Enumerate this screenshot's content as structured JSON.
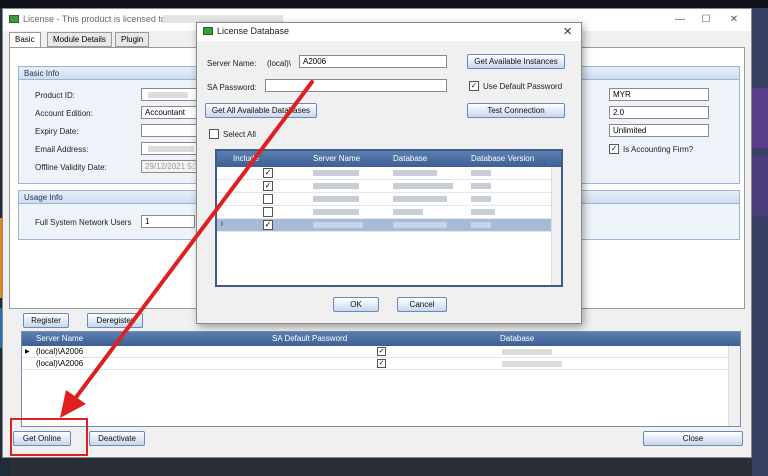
{
  "window": {
    "title": "License - This product is licensed to",
    "minimize": "—",
    "maximize": "☐",
    "close": "✕"
  },
  "tabs": [
    {
      "label": "Basic"
    },
    {
      "label": "Module Details"
    },
    {
      "label": "Plugin"
    }
  ],
  "basic_info": {
    "header": "Basic Info",
    "product_id_label": "Product ID:",
    "account_edition_label": "Account Edition:",
    "account_edition_value": "Accountant",
    "expiry_date_label": "Expiry Date:",
    "email_label": "Email Address:",
    "offline_validity_label": "Offline Validity Date:",
    "offline_validity_value": "29/12/2021 5:1",
    "currency_value": "MYR",
    "version_value": "2.0",
    "limit_value": "Unlimited",
    "accounting_firm_label": "Is Accounting Firm?"
  },
  "usage_info": {
    "header": "Usage Info",
    "full_users_label": "Full System Network Users",
    "full_users_value": "1"
  },
  "bottom": {
    "register": "Register",
    "deregister": "Deregister",
    "get_online": "Get Online",
    "deactivate": "Deactivate",
    "close": "Close"
  },
  "server_grid": {
    "columns": [
      "Server Name",
      "SA Default Password",
      "Database"
    ],
    "rows": [
      {
        "server": "(local)\\A2006",
        "sa_default": true
      },
      {
        "server": "(local)\\A2006",
        "sa_default": true
      }
    ]
  },
  "dialog": {
    "title": "License Database",
    "close": "✕",
    "server_name_label": "Server Name:",
    "server_prefix": "(local)\\",
    "server_value": "A2006",
    "sa_password_label": "SA Password:",
    "get_instances": "Get Available Instances",
    "use_default_password": "Use Default Password",
    "get_all_databases": "Get All Available Databases",
    "test_connection": "Test Connection",
    "select_all": "Select All",
    "grid_columns": [
      "Include",
      "Server Name",
      "Database",
      "Database Version"
    ],
    "grid_rows": [
      {
        "include": true
      },
      {
        "include": true
      },
      {
        "include": false
      },
      {
        "include": false
      },
      {
        "include": true
      }
    ],
    "ok": "OK",
    "cancel": "Cancel"
  },
  "colors": {
    "accent": "#3c5f95",
    "highlight": "#e02020"
  }
}
